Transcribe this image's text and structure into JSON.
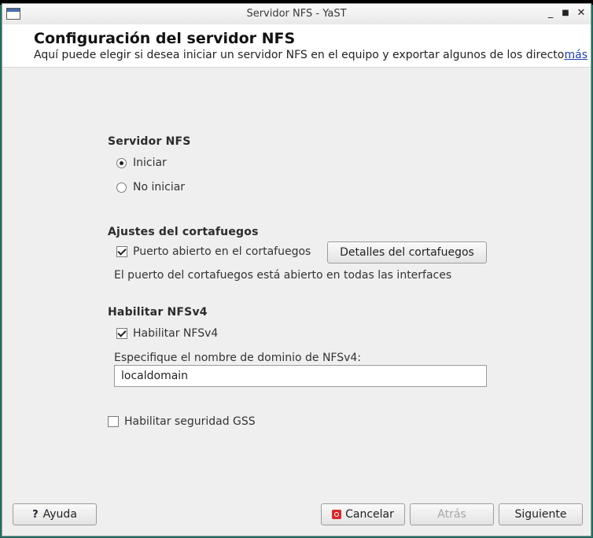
{
  "window": {
    "title": "Servidor NFS - YaST"
  },
  "header": {
    "title": "Configuración del servidor NFS",
    "description": "Aquí puede elegir si desea iniciar un servidor NFS en el equipo y exportar algunos de los directo…",
    "more_link": "más"
  },
  "nfs_server": {
    "label": "Servidor NFS",
    "options": [
      {
        "label": "Iniciar",
        "selected": true
      },
      {
        "label": "No iniciar",
        "selected": false
      }
    ]
  },
  "firewall": {
    "label": "Ajustes del cortafuegos",
    "open_port_label": "Puerto abierto en el cortafuegos",
    "open_port_checked": true,
    "details_button": "Detalles del cortafuegos",
    "status_text": "El puerto del cortafuegos está abierto en todas las interfaces"
  },
  "nfsv4": {
    "label": "Habilitar NFSv4",
    "enable_label": "Habilitar NFSv4",
    "enable_checked": true,
    "domain_label": "Especifique el nombre de dominio de NFSv4:",
    "domain_value": "localdomain"
  },
  "gss": {
    "label": "Habilitar seguridad GSS",
    "checked": false
  },
  "footer": {
    "help_label": "Ayuda",
    "cancel_label": "Cancelar",
    "back_label": "Atrás",
    "next_label": "Siguiente"
  }
}
